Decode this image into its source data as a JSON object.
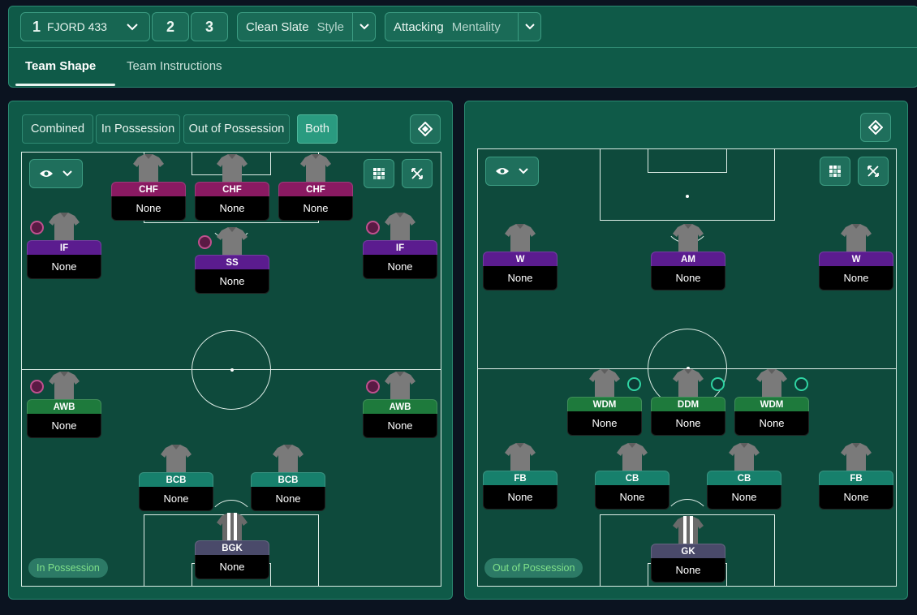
{
  "topbar": {
    "tactic_slots": [
      {
        "number": "1",
        "name": "FJORD 433"
      },
      {
        "number": "2"
      },
      {
        "number": "3"
      }
    ],
    "style": {
      "value": "Clean Slate",
      "label": "Style"
    },
    "mentality": {
      "value": "Attacking",
      "label": "Mentality"
    },
    "tabs": [
      {
        "label": "Team Shape",
        "active": true
      },
      {
        "label": "Team Instructions",
        "active": false
      }
    ]
  },
  "left_panel": {
    "view_modes": [
      {
        "label": "Combined",
        "active": false
      },
      {
        "label": "In Possession",
        "active": false
      },
      {
        "label": "Out of Possession",
        "active": false
      },
      {
        "label": "Both",
        "active": true
      }
    ],
    "pill": "In Possession",
    "players": [
      {
        "role": "CHF",
        "name": "None"
      },
      {
        "role": "CHF",
        "name": "None"
      },
      {
        "role": "CHF",
        "name": "None"
      },
      {
        "role": "IF",
        "name": "None"
      },
      {
        "role": "SS",
        "name": "None"
      },
      {
        "role": "IF",
        "name": "None"
      },
      {
        "role": "AWB",
        "name": "None"
      },
      {
        "role": "AWB",
        "name": "None"
      },
      {
        "role": "BCB",
        "name": "None"
      },
      {
        "role": "BCB",
        "name": "None"
      },
      {
        "role": "BGK",
        "name": "None"
      }
    ]
  },
  "right_panel": {
    "pill": "Out of Possession",
    "players": [
      {
        "role": "W",
        "name": "None"
      },
      {
        "role": "AM",
        "name": "None"
      },
      {
        "role": "W",
        "name": "None"
      },
      {
        "role": "WDM",
        "name": "None"
      },
      {
        "role": "DDM",
        "name": "None"
      },
      {
        "role": "WDM",
        "name": "None"
      },
      {
        "role": "FB",
        "name": "None"
      },
      {
        "role": "CB",
        "name": "None"
      },
      {
        "role": "CB",
        "name": "None"
      },
      {
        "role": "FB",
        "name": "None"
      },
      {
        "role": "GK",
        "name": "None"
      }
    ]
  },
  "colors": {
    "panel_bg": "#0f5a48",
    "pitch_bg": "#0e4a3c",
    "attack_role": "#8a1a62",
    "am_role": "#5b1c8f",
    "mid_role": "#1e7a3c",
    "def_role": "#17806c",
    "gk_role": "#4a4a6a"
  },
  "icons": [
    "chevron-down-icon",
    "eye-icon",
    "grid-icon",
    "expand-icon",
    "pitch-toggle-icon",
    "shirt-icon",
    "role-duty-icon"
  ]
}
